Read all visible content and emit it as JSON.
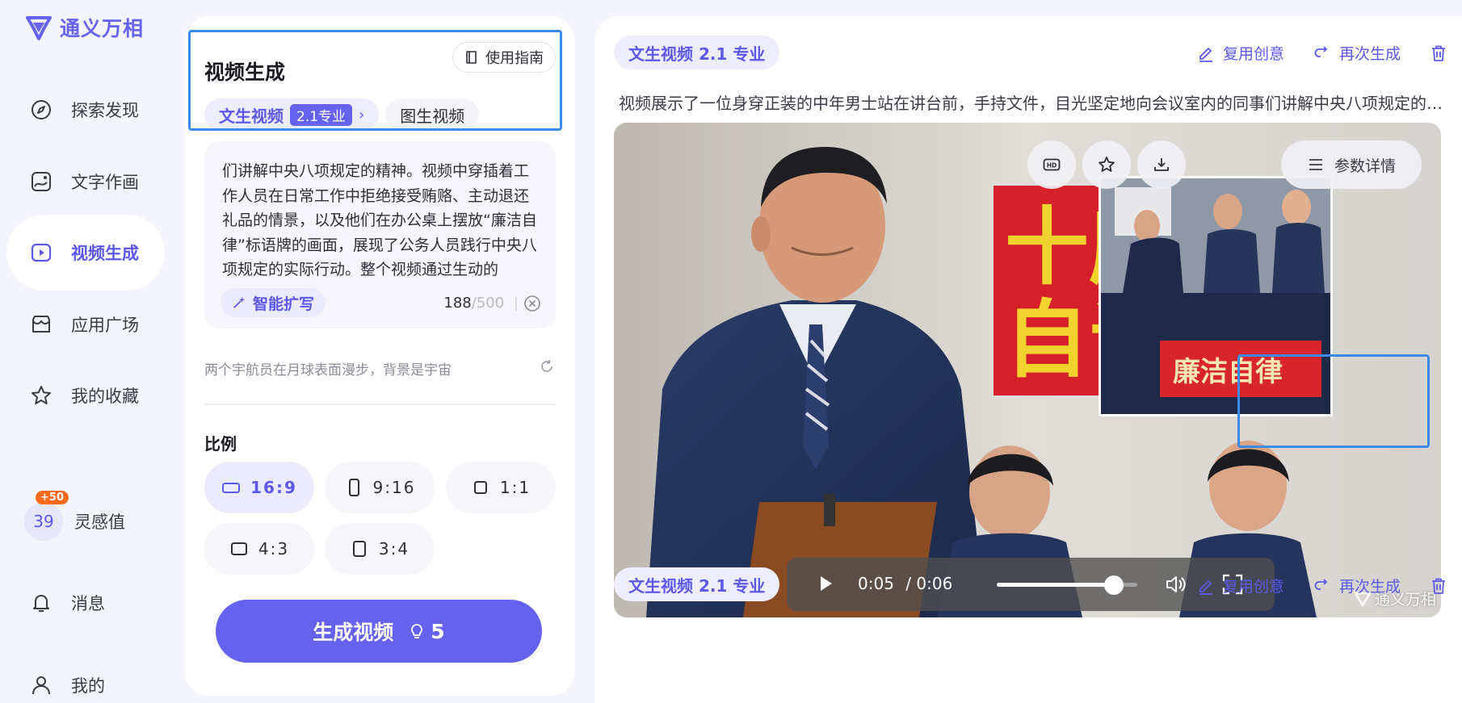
{
  "brand": {
    "name": "通义万相",
    "color": "#6563f0"
  },
  "sidebar": {
    "items": [
      {
        "label": "探索发现",
        "icon": "compass-icon"
      },
      {
        "label": "文字作画",
        "icon": "image-icon"
      },
      {
        "label": "视频生成",
        "icon": "video-play-icon",
        "active": true
      },
      {
        "label": "应用广场",
        "icon": "store-icon"
      },
      {
        "label": "我的收藏",
        "icon": "star-icon"
      },
      {
        "label": "灵感值",
        "icon": "inspiration-counter",
        "count": "39",
        "badge": "+50"
      },
      {
        "label": "消息",
        "icon": "bell-icon"
      },
      {
        "label": "我的",
        "icon": "user-icon"
      }
    ]
  },
  "panel": {
    "title": "视频生成",
    "guide_label": "使用指南",
    "tabs": [
      {
        "label": "文生视频",
        "version": "2.1专业",
        "active": true
      },
      {
        "label": "图生视频"
      }
    ],
    "prompt_text": "们讲解中央八项规定的精神。视频中穿插着工作人员在日常工作中拒绝接受贿赂、主动退还礼品的情景，以及他们在办公桌上摆放“廉洁自律”标语牌的画面，展现了公务人员践行中央八项规定的实际行动。整个视频通过生动的",
    "smart_expand_label": "智能扩写",
    "char_count": "188",
    "char_max": "/500",
    "suggestion": "两个宇航员在月球表面漫步，背景是宇宙",
    "ratio_title": "比例",
    "ratios": [
      {
        "label": "16:9",
        "active": true
      },
      {
        "label": "9:16"
      },
      {
        "label": "1:1"
      },
      {
        "label": "4:3"
      },
      {
        "label": "3:4"
      }
    ],
    "generate_label": "生成视频",
    "generate_cost": "5"
  },
  "result": {
    "badge": "文生视频 2.1 专业",
    "reuse_label": "复用创意",
    "regen_label": "再次生成",
    "description": "视频展示了一位身穿正装的中年男士站在讲台前，手持文件，目光坚定地向会议室内的同事们讲解中央八项规定的精...",
    "param_label": "参数详情",
    "current_time": "0:05",
    "duration": "/ 0:06",
    "progress": 0.833,
    "watermark": "通义万相",
    "wall_sign": "十廉自诂",
    "inset_sign": "廉洁自律"
  },
  "result2": {
    "badge": "文生视频 2.1 专业",
    "reuse_label": "复用创意",
    "regen_label": "再次生成"
  },
  "colors": {
    "accent": "#6462ef",
    "selection": "#3b8ae8",
    "badge_bg": "#eeedfd"
  }
}
